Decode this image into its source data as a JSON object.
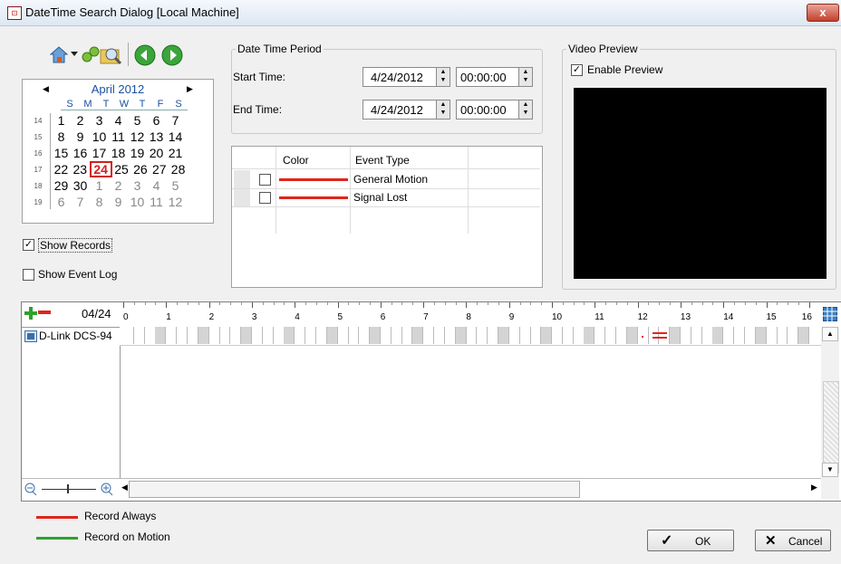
{
  "window": {
    "title": "DateTime Search Dialog  [Local Machine]",
    "close_label": "x"
  },
  "toolbar": {
    "icons": [
      "home-icon",
      "dropdown-arrow-icon",
      "link-icon",
      "search-folder-icon",
      "back-icon",
      "forward-icon"
    ]
  },
  "calendar": {
    "month_label": "April 2012",
    "prev": "◀",
    "next": "▶",
    "dow": [
      "S",
      "M",
      "T",
      "W",
      "T",
      "F",
      "S"
    ],
    "weeks": [
      "14",
      "15",
      "16",
      "17",
      "18",
      "19"
    ],
    "rows": [
      [
        "1",
        "2",
        "3",
        "4",
        "5",
        "6",
        "7"
      ],
      [
        "8",
        "9",
        "10",
        "11",
        "12",
        "13",
        "14"
      ],
      [
        "15",
        "16",
        "17",
        "18",
        "19",
        "20",
        "21"
      ],
      [
        "22",
        "23",
        "24",
        "25",
        "26",
        "27",
        "28"
      ],
      [
        "29",
        "30",
        "1",
        "2",
        "3",
        "4",
        "5"
      ],
      [
        "6",
        "7",
        "8",
        "9",
        "10",
        "11",
        "12"
      ]
    ],
    "selected": "24"
  },
  "options": {
    "show_records": "Show Records",
    "show_records_checked": true,
    "show_event_log": "Show Event Log",
    "show_event_log_checked": false
  },
  "period": {
    "legend": "Date Time Period",
    "start_label": "Start Time:",
    "start_date": "4/24/2012",
    "start_time": "00:00:00",
    "end_label": "End Time:",
    "end_date": "4/24/2012",
    "end_time": "00:00:00"
  },
  "events": {
    "col_color": "Color",
    "col_type": "Event Type",
    "rows": [
      {
        "type": "General Motion",
        "color": "#e0251a"
      },
      {
        "type": "Signal Lost",
        "color": "#e0251a"
      }
    ]
  },
  "preview": {
    "legend": "Video Preview",
    "enable_label": "Enable Preview",
    "enable_checked": true
  },
  "timeline": {
    "date": "04/24",
    "hours": [
      "0",
      "1",
      "2",
      "3",
      "4",
      "5",
      "6",
      "7",
      "8",
      "9",
      "10",
      "11",
      "12",
      "13",
      "14",
      "15",
      "16"
    ],
    "camera": "D-Link DCS-94",
    "scroll_left": "◀",
    "scroll_right": "▶"
  },
  "legend_items": [
    {
      "label": "Record Always",
      "color": "#e0251a"
    },
    {
      "label": "Record on Motion",
      "color": "#2ea12e"
    }
  ],
  "buttons": {
    "ok": "OK",
    "cancel": "Cancel"
  }
}
